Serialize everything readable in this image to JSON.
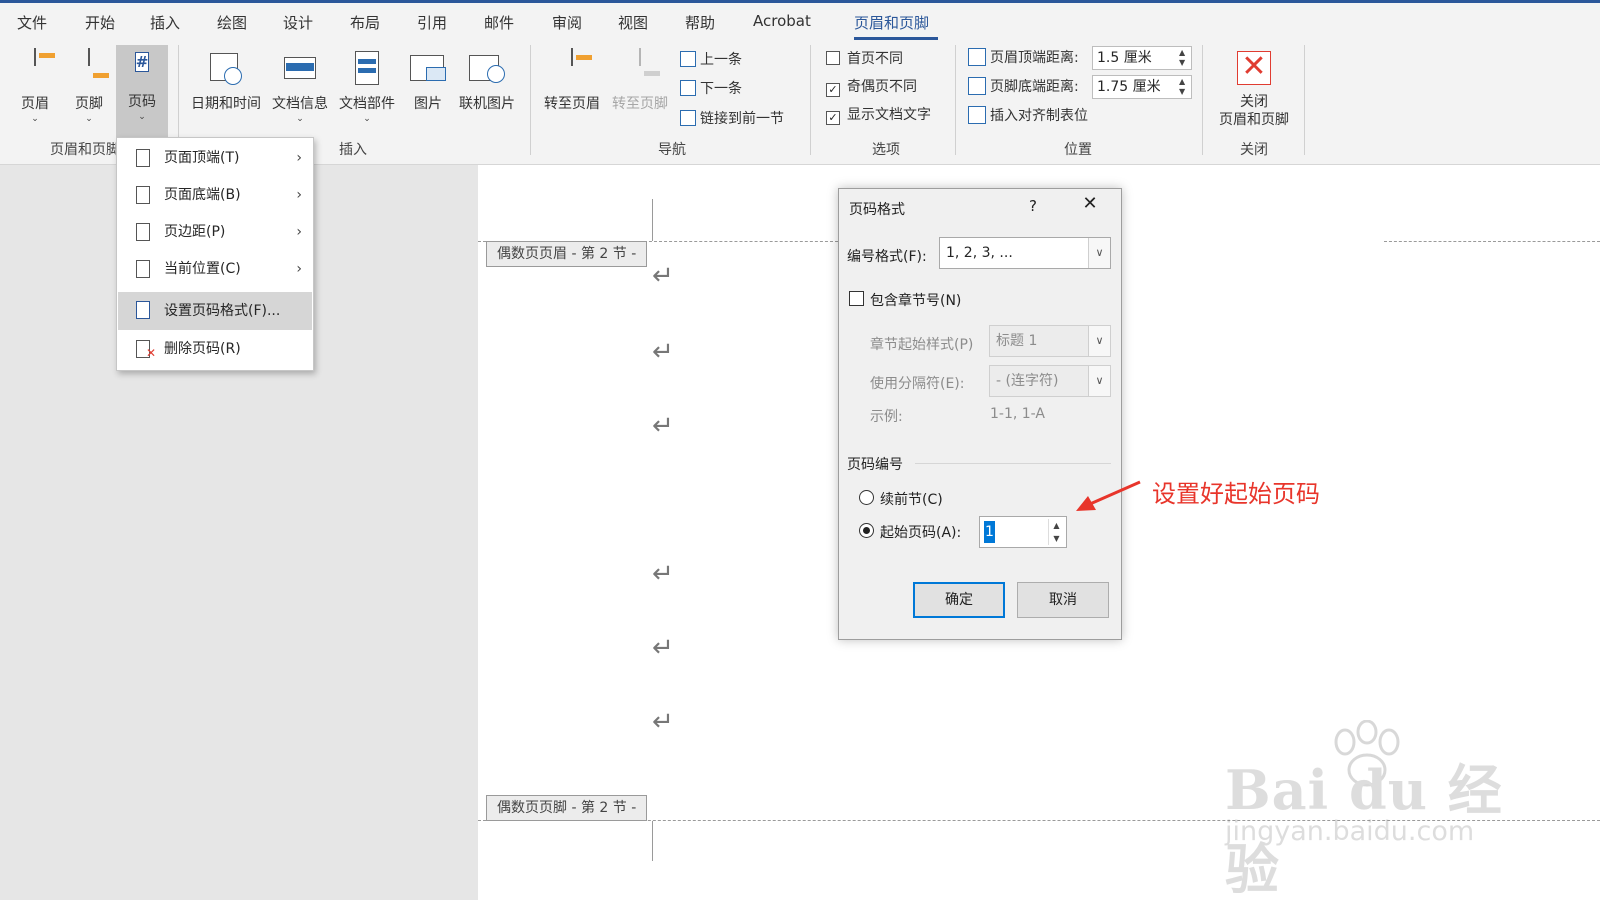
{
  "menu_tabs": [
    "文件",
    "开始",
    "插入",
    "绘图",
    "设计",
    "布局",
    "引用",
    "邮件",
    "审阅",
    "视图",
    "帮助",
    "Acrobat",
    "页眉和页脚"
  ],
  "active_tab": "页眉和页脚",
  "ribbon": {
    "hf_group": {
      "header": "页眉",
      "footer": "页脚",
      "page_number": "页码",
      "label": "页眉和页脚"
    },
    "insert_group": {
      "datetime": "日期和时间",
      "docinfo": "文档信息",
      "quickparts": "文档部件",
      "picture": "图片",
      "online_picture": "联机图片",
      "label": "插入"
    },
    "nav_group": {
      "goto_header": "转至页眉",
      "goto_footer": "转至页脚",
      "previous": "上一条",
      "next": "下一条",
      "link_previous": "链接到前一节",
      "label": "导航"
    },
    "options_group": {
      "first_page": {
        "label": "首页不同",
        "checked": false
      },
      "odd_even": {
        "label": "奇偶页不同",
        "checked": true
      },
      "show_text": {
        "label": "显示文档文字",
        "checked": true
      },
      "label": "选项"
    },
    "position_group": {
      "header_top_label": "页眉顶端距离:",
      "header_top_value": "1.5 厘米",
      "footer_bottom_label": "页脚底端距离:",
      "footer_bottom_value": "1.75 厘米",
      "insert_align_tab": "插入对齐制表位",
      "label": "位置"
    },
    "close_group": {
      "close_line1": "关闭",
      "close_line2": "页眉和页脚",
      "label": "关闭"
    }
  },
  "dropdown": {
    "items": [
      {
        "label": "页面顶端(T)",
        "submenu": true
      },
      {
        "label": "页面底端(B)",
        "submenu": true
      },
      {
        "label": "页边距(P)",
        "submenu": true
      },
      {
        "label": "当前位置(C)",
        "submenu": true
      },
      {
        "label": "设置页码格式(F)...",
        "submenu": false
      },
      {
        "label": "删除页码(R)",
        "submenu": false
      }
    ],
    "highlighted_index": 4
  },
  "document": {
    "header_tag": "偶数页页眉 - 第 2 节 -",
    "footer_tag": "偶数页页脚 - 第 2 节 -",
    "paragraph_mark": "↵"
  },
  "dialog": {
    "title": "页码格式",
    "help": "?",
    "number_format_label": "编号格式(F):",
    "number_format_value": "1, 2, 3, ...",
    "include_chapter_label": "包含章节号(N)",
    "include_chapter_checked": false,
    "chapter_style_label": "章节起始样式(P)",
    "chapter_style_value": "标题 1",
    "separator_label": "使用分隔符(E):",
    "separator_value": "-  (连字符)",
    "example_label": "示例:",
    "example_value": "1-1, 1-A",
    "page_numbering_label": "页码编号",
    "continue_label": "续前节(C)",
    "start_at_label": "起始页码(A):",
    "start_at_value": "1",
    "start_at_selected": true,
    "ok": "确定",
    "cancel": "取消"
  },
  "annotation": {
    "text": "设置好起始页码",
    "color": "#e8352b"
  },
  "watermark": {
    "line1": "Bai du 经验",
    "line2": "jingyan.baidu.com"
  },
  "colors": {
    "accent": "#2b579a",
    "selection": "#0078d7"
  }
}
